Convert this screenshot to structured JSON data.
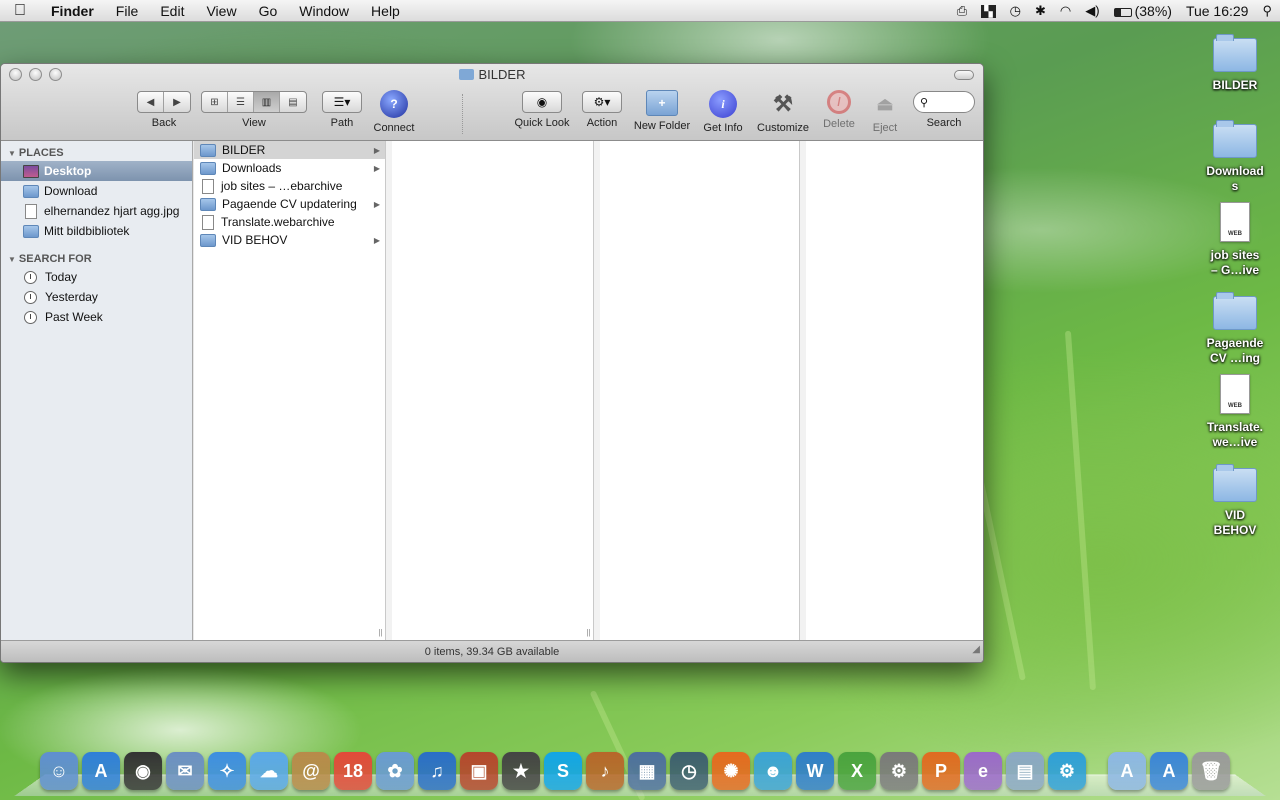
{
  "menubar": {
    "app_name": "Finder",
    "menus": [
      "File",
      "Edit",
      "View",
      "Go",
      "Window",
      "Help"
    ],
    "battery": "(38%)",
    "clock": "Tue 16:29"
  },
  "window": {
    "title": "BILDER",
    "toolbar": {
      "back": "Back",
      "view": "View",
      "path": "Path",
      "connect": "Connect",
      "quick_look": "Quick Look",
      "action": "Action",
      "new_folder": "New Folder",
      "get_info": "Get Info",
      "customize": "Customize",
      "delete": "Delete",
      "eject": "Eject",
      "search": "Search"
    },
    "sidebar": {
      "places_header": "PLACES",
      "places": [
        "Desktop",
        "Download",
        "elhernandez hjart agg.jpg",
        "Mitt bildbibliotek"
      ],
      "search_header": "SEARCH FOR",
      "searches": [
        "Today",
        "Yesterday",
        "Past Week"
      ]
    },
    "column1": [
      {
        "label": "BILDER",
        "kind": "folder",
        "has_children": true
      },
      {
        "label": "Downloads",
        "kind": "folder",
        "has_children": true
      },
      {
        "label": "job sites – …ebarchive",
        "kind": "file",
        "has_children": false
      },
      {
        "label": "Pagaende CV updatering",
        "kind": "folder",
        "has_children": true
      },
      {
        "label": "Translate.webarchive",
        "kind": "file",
        "has_children": false
      },
      {
        "label": "VID BEHOV",
        "kind": "folder",
        "has_children": true
      }
    ],
    "status": "0 items, 39.34 GB available"
  },
  "desktop": {
    "icons": [
      {
        "line1": "BILDER",
        "line2": "",
        "kind": "folder"
      },
      {
        "line1": "Download",
        "line2": "s",
        "kind": "folder"
      },
      {
        "line1": "job sites",
        "line2": "– G…ive",
        "kind": "doc",
        "doc_tag": "WEB"
      },
      {
        "line1": "Pagaende",
        "line2": "CV …ing",
        "kind": "folder"
      },
      {
        "line1": "Translate.",
        "line2": "we…ive",
        "kind": "doc",
        "doc_tag": "WEB"
      },
      {
        "line1": "VID",
        "line2": "BEHOV",
        "kind": "folder"
      }
    ]
  },
  "dock": {
    "apps": [
      {
        "name": "finder-icon",
        "glyph": "☺",
        "color": "#5f8fd0"
      },
      {
        "name": "app-store-icon",
        "glyph": "A",
        "color": "#2f7fd8"
      },
      {
        "name": "dashboard-icon",
        "glyph": "◉",
        "color": "#333333"
      },
      {
        "name": "mail-icon",
        "glyph": "✉",
        "color": "#6b8fc2"
      },
      {
        "name": "safari-icon",
        "glyph": "✧",
        "color": "#3d8ee0"
      },
      {
        "name": "ichat-icon",
        "glyph": "☁",
        "color": "#5aa8e8"
      },
      {
        "name": "address-book-icon",
        "glyph": "@",
        "color": "#b88a4a"
      },
      {
        "name": "ical-icon",
        "glyph": "18",
        "color": "#e24a3a"
      },
      {
        "name": "iphoto-icon",
        "glyph": "✿",
        "color": "#6a9bd2"
      },
      {
        "name": "itunes-icon",
        "glyph": "♫",
        "color": "#2a6ec8"
      },
      {
        "name": "photo-booth-icon",
        "glyph": "▣",
        "color": "#b5472d"
      },
      {
        "name": "imovie-icon",
        "glyph": "★",
        "color": "#444444"
      },
      {
        "name": "skype-icon",
        "glyph": "S",
        "color": "#12a5e6"
      },
      {
        "name": "garageband-icon",
        "glyph": "♪",
        "color": "#b7672a"
      },
      {
        "name": "spaces-icon",
        "glyph": "▦",
        "color": "#4d6f9e"
      },
      {
        "name": "time-machine-icon",
        "glyph": "◷",
        "color": "#3d5f6f"
      },
      {
        "name": "firefox-icon",
        "glyph": "✺",
        "color": "#e56a1f"
      },
      {
        "name": "messenger-icon",
        "glyph": "☻",
        "color": "#3ba3d6"
      },
      {
        "name": "word-icon",
        "glyph": "W",
        "color": "#2f7ec9"
      },
      {
        "name": "excel-icon",
        "glyph": "X",
        "color": "#4aa33e"
      },
      {
        "name": "system-preferences-icon",
        "glyph": "⚙",
        "color": "#7a7a7a"
      },
      {
        "name": "powerpoint-icon",
        "glyph": "P",
        "color": "#e06b21"
      },
      {
        "name": "entourage-icon",
        "glyph": "e",
        "color": "#9b6ac9"
      },
      {
        "name": "preview-icon",
        "glyph": "▤",
        "color": "#8aa7c4"
      },
      {
        "name": "utility-icon",
        "glyph": "⚙",
        "color": "#2e9fd8"
      }
    ],
    "right": [
      {
        "name": "applications-stack-icon",
        "glyph": "A",
        "color": "#8db7e4"
      },
      {
        "name": "downloads-stack-icon",
        "glyph": "A",
        "color": "#3a85d8"
      },
      {
        "name": "trash-icon",
        "glyph": "🗑",
        "color": "#9a9a9a"
      }
    ]
  }
}
